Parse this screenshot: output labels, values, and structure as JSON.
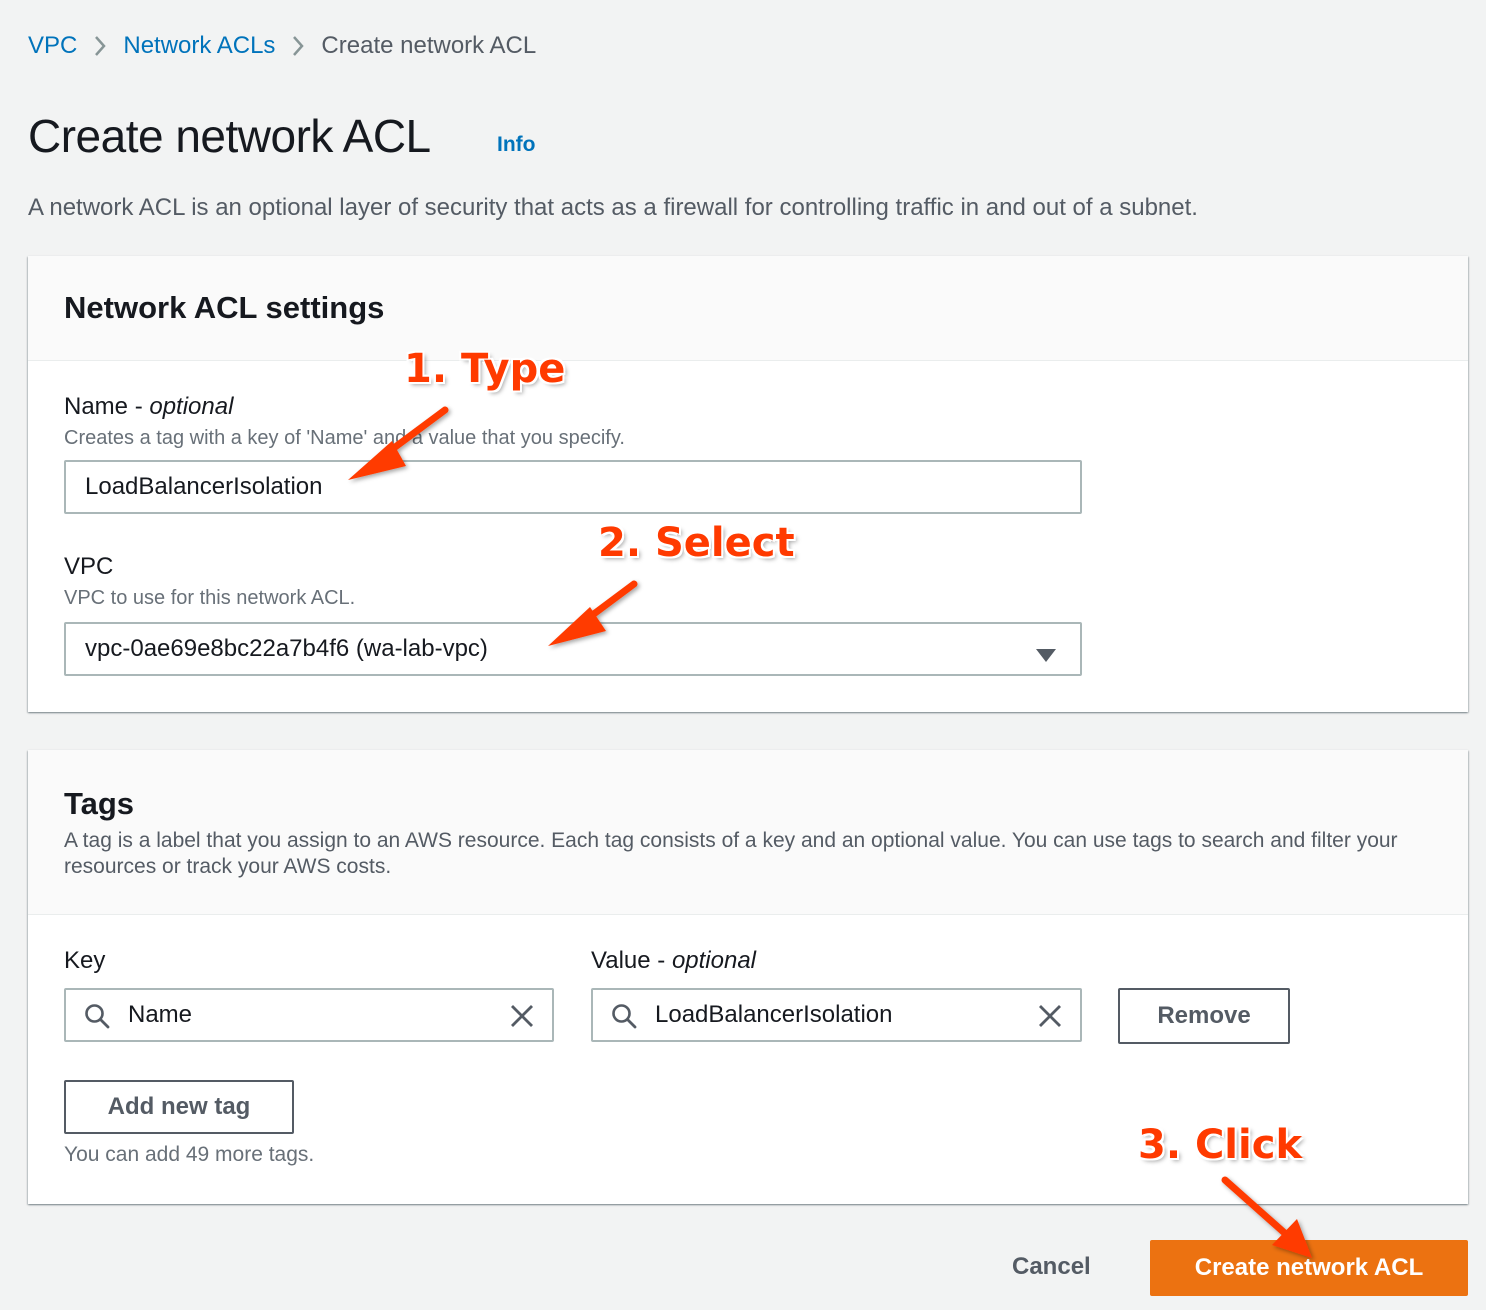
{
  "breadcrumb": {
    "items": [
      "VPC",
      "Network ACLs",
      "Create network ACL"
    ]
  },
  "header": {
    "title": "Create network ACL",
    "info": "Info",
    "description": "A network ACL is an optional layer of security that acts as a firewall for controlling traffic in and out of a subnet."
  },
  "settings": {
    "title": "Network ACL settings",
    "name_label": "Name",
    "name_label_sep": " - ",
    "name_optional": "optional",
    "name_hint": "Creates a tag with a key of 'Name' and a value that you specify.",
    "name_value": "LoadBalancerIsolation",
    "vpc_label": "VPC",
    "vpc_hint": "VPC to use for this network ACL.",
    "vpc_value": "vpc-0ae69e8bc22a7b4f6 (wa-lab-vpc)"
  },
  "tags": {
    "title": "Tags",
    "description": "A tag is a label that you assign to an AWS resource. Each tag consists of a key and an optional value. You can use tags to search and filter your resources or track your AWS costs.",
    "key_label": "Key",
    "value_label": "Value",
    "value_label_sep": " - ",
    "value_optional": "optional",
    "key_value": "Name",
    "value_value": "LoadBalancerIsolation",
    "remove_label": "Remove",
    "add_label": "Add new tag",
    "limit_text": "You can add 49 more tags."
  },
  "footer": {
    "cancel_label": "Cancel",
    "create_label": "Create network ACL"
  },
  "annotations": {
    "step1": "1. Type",
    "step2": "2. Select",
    "step3": "3. Click"
  },
  "colors": {
    "link": "#0073bb",
    "primary": "#ec7211",
    "annotation": "#ff3a00",
    "background": "#f2f3f3"
  }
}
